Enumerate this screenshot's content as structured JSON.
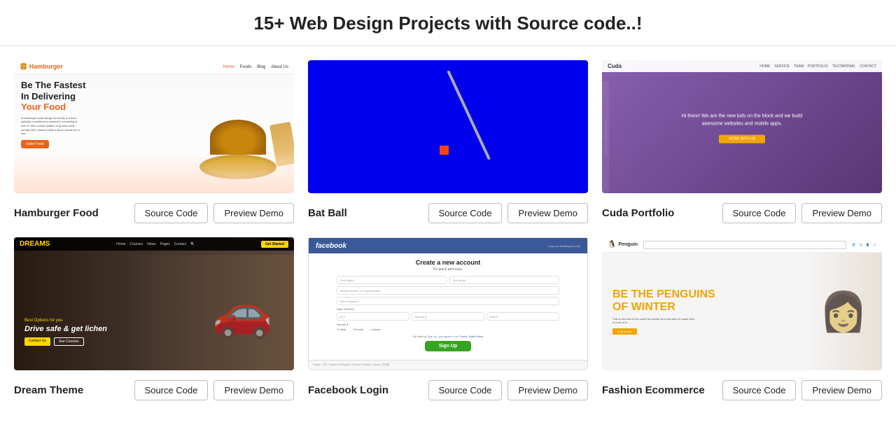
{
  "page": {
    "title": "15+ Web Design Projects with Source code..!"
  },
  "cards": [
    {
      "id": "hamburger-food",
      "title": "Hamburger Food",
      "theme": "hamburger",
      "source_label": "Source Code",
      "preview_label": "Preview Demo"
    },
    {
      "id": "bat-ball",
      "title": "Bat Ball",
      "theme": "batball",
      "source_label": "Source Code",
      "preview_label": "Preview Demo"
    },
    {
      "id": "cuda-portfolio",
      "title": "Cuda Portfolio",
      "theme": "cuda",
      "source_label": "Source Code",
      "preview_label": "Preview Demo"
    },
    {
      "id": "dream-theme",
      "title": "Dream Theme",
      "theme": "dream",
      "source_label": "Source Code",
      "preview_label": "Preview Demo"
    },
    {
      "id": "facebook-login",
      "title": "Facebook Login",
      "theme": "facebook",
      "source_label": "Source Code",
      "preview_label": "Preview Demo"
    },
    {
      "id": "fashion-ecommerce",
      "title": "Fashion Ecommerce",
      "theme": "fashion",
      "source_label": "Source Code",
      "preview_label": "Preview Demo"
    }
  ]
}
